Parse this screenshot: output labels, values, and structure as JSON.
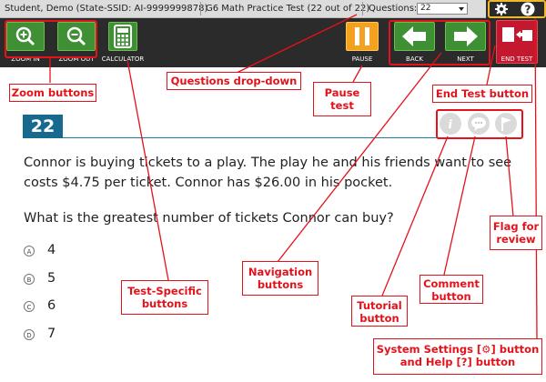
{
  "header": {
    "student": "Student, Demo (State-SSID: AI-9999999878)",
    "test_name": "G6 Math Practice Test (22 out of 22)",
    "questions_label": "Questions:",
    "questions_selected": "22",
    "settings_icon": "gear-icon",
    "help_icon": "question-icon"
  },
  "toolbar": {
    "zoom_in": "ZOOM IN",
    "zoom_out": "ZOOM OUT",
    "calculator": "CALCULATOR",
    "pause": "PAUSE",
    "back": "BACK",
    "next": "NEXT",
    "end_test": "END TEST"
  },
  "question": {
    "number": "22",
    "text": "Connor is buying tickets to a play. The play he and his friends want to see costs $4.75 per ticket. Connor has $26.00 in his pocket.",
    "prompt": "What is the greatest number of tickets Connor can buy?",
    "choices": [
      {
        "letter": "A",
        "value": "4"
      },
      {
        "letter": "B",
        "value": "5"
      },
      {
        "letter": "C",
        "value": "6"
      },
      {
        "letter": "D",
        "value": "7"
      }
    ]
  },
  "callouts": {
    "zoom": "Zoom buttons",
    "questions": "Questions drop-down",
    "pause": "Pause test",
    "end_test": "End Test button",
    "flag": "Flag for review",
    "navigation": "Navigation buttons",
    "test_specific": "Test-Specific buttons",
    "comment": "Comment button",
    "tutorial": "Tutorial button",
    "system": "System Settings [⚙] button and Help [?] button"
  },
  "colors": {
    "accent_red": "#e4121b",
    "accent_gold": "#f1b82b",
    "nav_green": "#3f8f34",
    "pause_orange": "#f4a11f",
    "end_red": "#c3182e",
    "question_blue": "#176a8e"
  }
}
